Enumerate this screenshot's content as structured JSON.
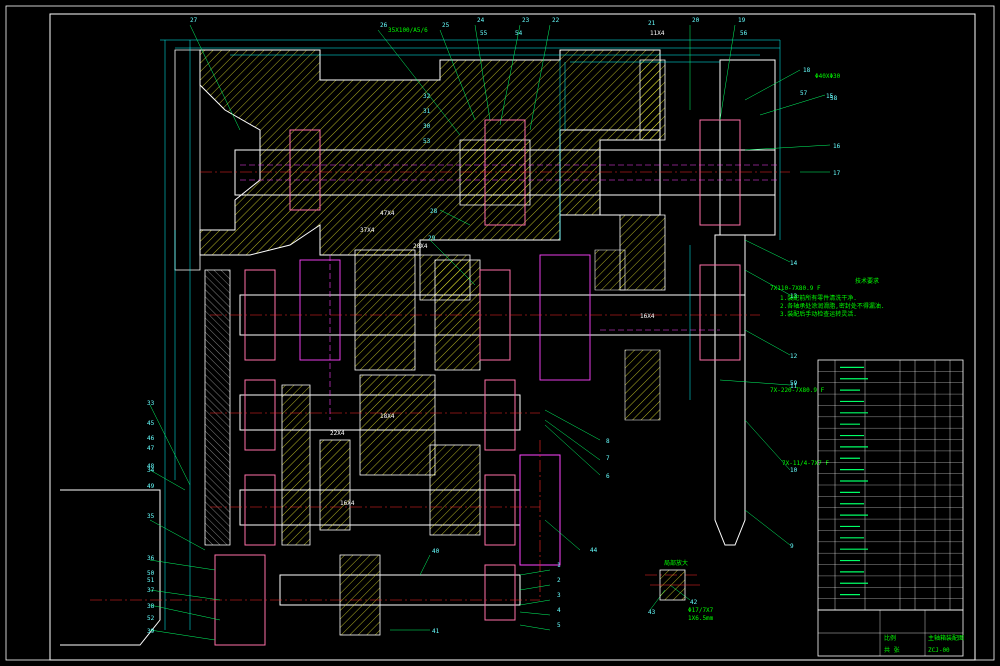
{
  "colors": {
    "background": "#000000",
    "frame": "#ffffff",
    "outline": "#ffffff",
    "hatch": "#ffff33",
    "dimension": "#00ffff",
    "centerline": "#ff2a2a",
    "shaft_axis": "#ff44ff",
    "bearing": "#ff6fa8",
    "leader": "#00ff66",
    "table": "#00ff66"
  },
  "annotations": {
    "top_gear": "11X4",
    "upper_mesh": "47X4",
    "left_mesh": "37X4",
    "mid_gear": "20X4",
    "shaft_mark": "16X4",
    "low_gear": "18X4",
    "low_gear_2": "22X4",
    "bottom_shaft": "16X4",
    "fit_1": "7X110-7X80.9 F",
    "fit_2": "7X-220-7X80.9 F",
    "fit_3": "7X-11/4-7X7 F",
    "top_fit": "35X100/A5/6",
    "spec_right": "Φ40XΦ30",
    "detail_title": "局部放大",
    "detail_fit": "Φ17/7X7",
    "detail_fit_2": "1X6.5mm",
    "tech_heading": "技术要求",
    "tech_line_1": "1.装配前所有零件清洗干净.",
    "tech_line_2": "2.各轴承处涂润滑脂,密封处不得漏油.",
    "tech_line_3": "3.装配后手动检查运转灵活."
  },
  "part_numbers": [
    "1",
    "2",
    "3",
    "4",
    "5",
    "6",
    "7",
    "8",
    "9",
    "10",
    "11",
    "12",
    "13",
    "14",
    "15",
    "16",
    "17",
    "18",
    "19",
    "20",
    "21",
    "22",
    "23",
    "24",
    "25",
    "26",
    "27",
    "28",
    "29",
    "30",
    "31",
    "32",
    "33",
    "34",
    "35",
    "36",
    "37",
    "38",
    "39",
    "40",
    "41",
    "42",
    "43",
    "44",
    "45",
    "46",
    "47",
    "48",
    "49",
    "50",
    "51",
    "52",
    "53",
    "54",
    "55",
    "56",
    "57",
    "58",
    "59"
  ],
  "title_block": {
    "drawing_name": "主轴箱装配图",
    "scale_label": "比例",
    "sheet_label": "共 张",
    "code": "ZCJ-00"
  },
  "bom_rows": 22
}
